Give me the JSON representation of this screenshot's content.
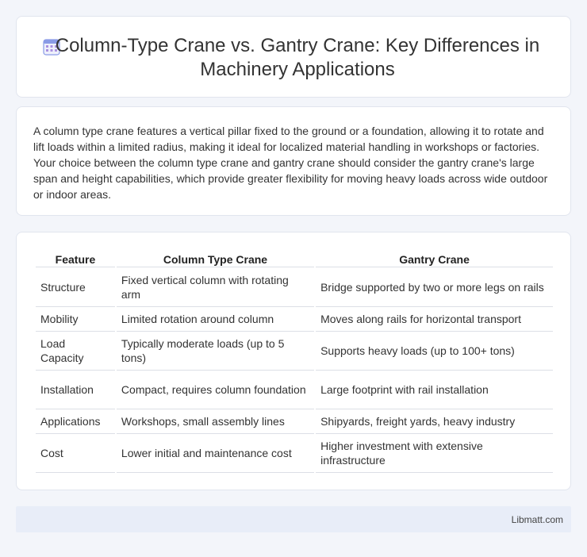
{
  "header": {
    "title": "Column-Type Crane vs. Gantry Crane: Key Differences in Machinery Applications",
    "icon": "calendar-icon",
    "icon_color": "#7b8fe0"
  },
  "description": "A column type crane features a vertical pillar fixed to the ground or a foundation, allowing it to rotate and lift loads within a limited radius, making it ideal for localized material handling in workshops or factories. Your choice between the column type crane and gantry crane should consider the gantry crane's large span and height capabilities, which provide greater flexibility for moving heavy loads across wide outdoor or indoor areas.",
  "table": {
    "headers": [
      "Feature",
      "Column Type Crane",
      "Gantry Crane"
    ],
    "rows": [
      [
        "Structure",
        "Fixed vertical column with rotating arm",
        "Bridge supported by two or more legs on rails"
      ],
      [
        "Mobility",
        "Limited rotation around column",
        "Moves along rails for horizontal transport"
      ],
      [
        "Load Capacity",
        "Typically moderate loads (up to 5 tons)",
        "Supports heavy loads (up to 100+ tons)"
      ],
      [
        "Installation",
        "Compact, requires column foundation",
        "Large footprint with rail installation"
      ],
      [
        "Applications",
        "Workshops, small assembly lines",
        "Shipyards, freight yards, heavy industry"
      ],
      [
        "Cost",
        "Lower initial and maintenance cost",
        "Higher investment with extensive infrastructure"
      ]
    ]
  },
  "footer": {
    "brand": "Libmatt.com"
  }
}
